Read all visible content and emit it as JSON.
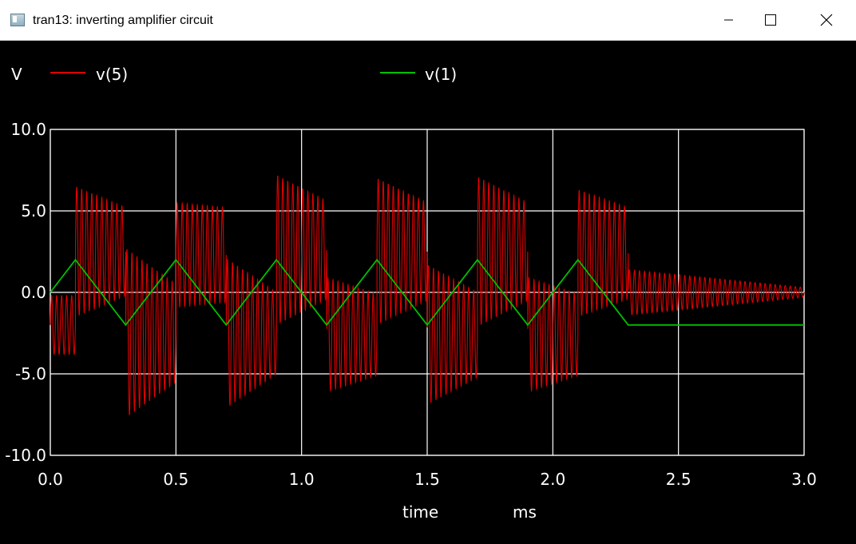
{
  "window": {
    "title": "tran13: inverting amplifier circuit",
    "icons": {
      "app": "app-window-icon",
      "minimize": "minimize-icon",
      "maximize": "maximize-icon",
      "close": "close-icon"
    }
  },
  "colors": {
    "background": "#000000",
    "grid": "#ffffff",
    "v5": "#e00000",
    "v1": "#00c000",
    "text": "#ffffff"
  },
  "chart_data": {
    "type": "line",
    "unit_label": "V",
    "xlabel": "time",
    "xunit": "ms",
    "xlim": [
      0.0,
      3.0
    ],
    "ylim": [
      -10.0,
      10.0
    ],
    "xticks": [
      "0.0",
      "0.5",
      "1.0",
      "1.5",
      "2.0",
      "2.5",
      "3.0"
    ],
    "yticks": [
      "10.0",
      "5.0",
      "0.0",
      "-5.0",
      "-10.0"
    ],
    "grid": true,
    "legend_position": "top",
    "series": [
      {
        "name": "v(5)",
        "color": "#e00000",
        "description_values": {
          "oscillation_freq_khz": 50,
          "driven_until_ms": 2.3,
          "segments": [
            {
              "t0": 0.0,
              "t1": 0.1,
              "center": -2.0,
              "amp": 1.8
            },
            {
              "t0": 0.1,
              "t1": 0.3,
              "center": 2.5,
              "amp": 4.0,
              "decay_to": 2.7
            },
            {
              "t0": 0.3,
              "t1": 0.5,
              "center": -2.5,
              "amp": 5.2,
              "decay_to": 3.0
            },
            {
              "t0": 0.5,
              "t1": 0.7,
              "center": 2.3,
              "amp": 3.2,
              "decay_to": 2.9
            },
            {
              "t0": 0.7,
              "t1": 0.9,
              "center": -2.5,
              "amp": 4.6,
              "decay_to": 2.5
            },
            {
              "t0": 0.9,
              "t1": 1.1,
              "center": 2.6,
              "amp": 4.6,
              "decay_to": 3.0
            },
            {
              "t0": 1.1,
              "t1": 1.3,
              "center": -2.6,
              "amp": 3.5,
              "decay_to": 2.5
            },
            {
              "t0": 1.3,
              "t1": 1.5,
              "center": 2.5,
              "amp": 4.5,
              "decay_to": 3.0
            },
            {
              "t0": 1.5,
              "t1": 1.7,
              "center": -2.6,
              "amp": 4.3,
              "decay_to": 2.6
            },
            {
              "t0": 1.7,
              "t1": 1.9,
              "center": 2.5,
              "amp": 4.6,
              "decay_to": 3.0
            },
            {
              "t0": 1.9,
              "t1": 2.1,
              "center": -2.6,
              "amp": 3.5,
              "decay_to": 2.5
            },
            {
              "t0": 2.1,
              "t1": 2.3,
              "center": 2.4,
              "amp": 3.9,
              "decay_to": 2.8
            },
            {
              "t0": 2.3,
              "t1": 3.0,
              "center": 0.0,
              "amp": 1.4,
              "decay_to": 0.3
            }
          ]
        }
      },
      {
        "name": "v(1)",
        "color": "#00c000",
        "x": [
          0.0,
          0.1,
          0.3,
          0.5,
          0.7,
          0.9,
          1.1,
          1.3,
          1.5,
          1.7,
          1.9,
          2.1,
          2.3,
          3.0
        ],
        "values": [
          0.0,
          2.0,
          -2.0,
          2.0,
          -2.0,
          2.0,
          -2.0,
          2.0,
          -2.0,
          2.0,
          -2.0,
          2.0,
          -2.0,
          -2.0
        ]
      }
    ]
  }
}
